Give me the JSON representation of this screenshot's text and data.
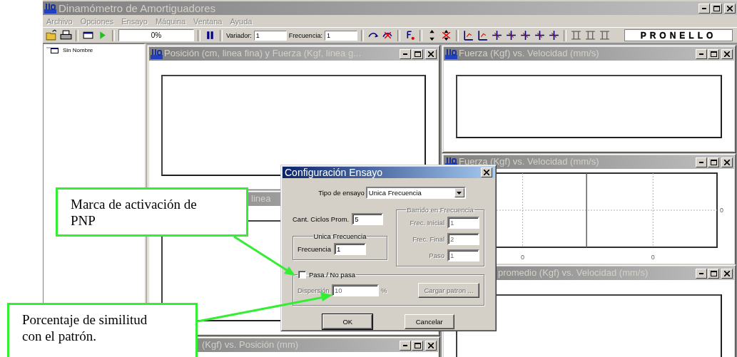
{
  "window": {
    "title": "Dinamómetro de Amortiguadores"
  },
  "menu": [
    {
      "label": "Archivo"
    },
    {
      "label": "Opciones"
    },
    {
      "label": "Ensayo"
    },
    {
      "label": "Máquina"
    },
    {
      "label": "Ventana"
    },
    {
      "label": "Ayuda"
    }
  ],
  "toolbar": {
    "progress": {
      "text": "0%",
      "level": 0
    },
    "variador": {
      "label": "Variador:",
      "value": "1"
    },
    "frecuencia": {
      "label": "Frecuencia:",
      "value": "1"
    },
    "logo": "PRONELLO"
  },
  "tree": {
    "items": [
      {
        "label": "Sin Nombre"
      }
    ]
  },
  "child_windows": [
    {
      "title": "Posición (cm, linea fina) y Fuerza (Kgf, linea g...",
      "kind": "plot"
    },
    {
      "title": "linea",
      "kind": "plot"
    },
    {
      "title": "(Kgf) vs. Posición (mm)",
      "kind": "plot"
    },
    {
      "title": "Fuerza (Kgf) vs. Velocidad (mm/s)",
      "kind": "plot"
    },
    {
      "title": "Fuerza (Kgf) vs. Velocidad (mm/s)",
      "kind": "axes",
      "x_tick_labels": [
        "0",
        "0"
      ],
      "y_tick_labels": [
        "0"
      ]
    },
    {
      "title": "promedio (Kgf) vs. Velocidad (mm/s)",
      "kind": "plot"
    }
  ],
  "dialog": {
    "title": "Configuración Ensayo",
    "test_type": {
      "label": "Tipo de ensayo",
      "value": "Unica Frecuencia"
    },
    "cycles": {
      "label": "Cant. Ciclos Prom.",
      "value": "5"
    },
    "single_frequency": {
      "title": "Unica Frecuencia",
      "disabled": false,
      "fields": [
        {
          "label": "Frecuencia",
          "value": "1"
        }
      ]
    },
    "sweep": {
      "title": "Barrido en Frecuencia",
      "disabled": true,
      "fields": [
        {
          "label": "Frec. Inicial",
          "value": "1"
        },
        {
          "label": "Frec. Final",
          "value": "2"
        },
        {
          "label": "Paso",
          "value": "1"
        }
      ]
    },
    "pass_fail": {
      "label": "Pasa / No pasa",
      "checked": false,
      "dispersion": {
        "label": "Dispersión",
        "value": "10",
        "unit": "%",
        "disabled": true
      },
      "load_button": {
        "label": "Cargar patron ...",
        "disabled": true
      }
    },
    "buttons": [
      {
        "label": "OK",
        "default": true
      },
      {
        "label": "Cancelar",
        "default": false
      }
    ]
  },
  "callouts": [
    {
      "text": "Marca de activación de PNP"
    },
    {
      "text": "Porcentaje de similitud con el patrón."
    }
  ]
}
